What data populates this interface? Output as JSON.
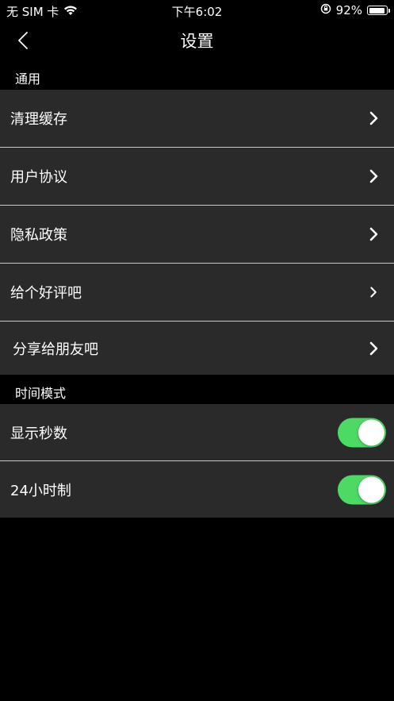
{
  "status_bar": {
    "carrier": "无 SIM 卡",
    "time": "下午6:02",
    "battery_percent": "92%",
    "battery_level": 0.92
  },
  "nav": {
    "title": "设置"
  },
  "sections": {
    "general": {
      "header": "通用",
      "items": [
        {
          "label": "清理缓存"
        },
        {
          "label": "用户协议"
        },
        {
          "label": "隐私政策"
        },
        {
          "label": "给个好评吧"
        },
        {
          "label": "分享给朋友吧"
        }
      ]
    },
    "time_mode": {
      "header": "时间模式",
      "items": [
        {
          "label": "显示秒数",
          "on": true
        },
        {
          "label": "24小时制",
          "on": true
        }
      ]
    }
  },
  "colors": {
    "background": "#000000",
    "row_background": "#2a2a2a",
    "toggle_on": "#4cd964"
  }
}
